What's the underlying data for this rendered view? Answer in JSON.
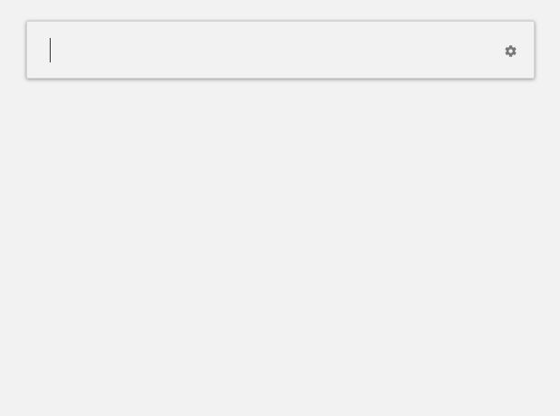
{
  "launcher": {
    "query": "",
    "placeholder": ""
  },
  "icons": {
    "settings": "gear-icon"
  },
  "colors": {
    "background": "#f2f2f2",
    "icon": "#777777",
    "cursor": "#333333"
  }
}
